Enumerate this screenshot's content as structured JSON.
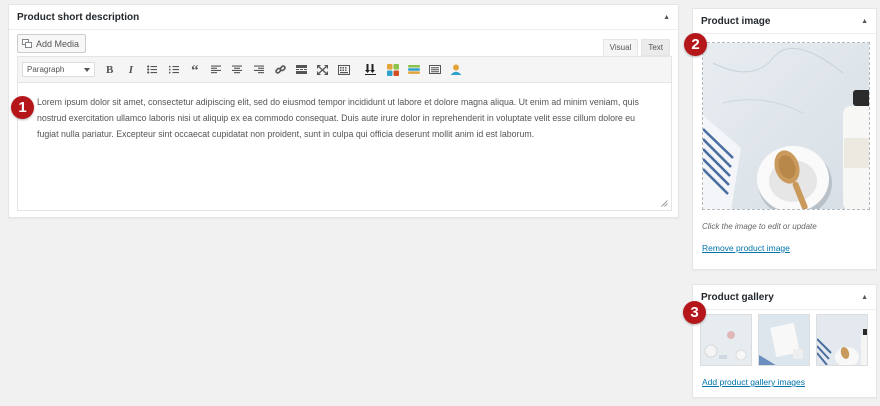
{
  "description_box": {
    "title": "Product short description",
    "add_media_label": "Add Media",
    "tabs": {
      "visual": "Visual",
      "text": "Text"
    },
    "format_select": "Paragraph",
    "content": "Lorem ipsum dolor sit amet, consectetur adipiscing elit, sed do eiusmod tempor incididunt ut labore et dolore magna aliqua. Ut enim ad minim veniam, quis nostrud exercitation ullamco laboris nisi ut aliquip ex ea commodo consequat. Duis aute irure dolor in reprehenderit in voluptate velit esse cillum dolore eu fugiat nulla pariatur. Excepteur sint occaecat cupidatat non proident, sunt in culpa qui officia deserunt mollit anim id est laborum."
  },
  "image_box": {
    "title": "Product image",
    "hint": "Click the image to edit or update",
    "remove_link": "Remove product image"
  },
  "gallery_box": {
    "title": "Product gallery",
    "add_link": "Add product gallery images"
  },
  "badges": [
    "1",
    "2",
    "3"
  ],
  "colors": {
    "badge": "#b5161a",
    "link": "#0073aa"
  },
  "toolbar_icons": [
    "bold-icon",
    "italic-icon",
    "bulleted-list-icon",
    "numbered-list-icon",
    "blockquote-icon",
    "align-left-icon",
    "align-center-icon",
    "align-right-icon",
    "link-icon",
    "read-more-icon",
    "fullscreen-icon",
    "toolbar-toggle-icon",
    "shortcode-icon",
    "color-blocks-icon",
    "layers-icon",
    "layout-icon",
    "user-icon"
  ]
}
